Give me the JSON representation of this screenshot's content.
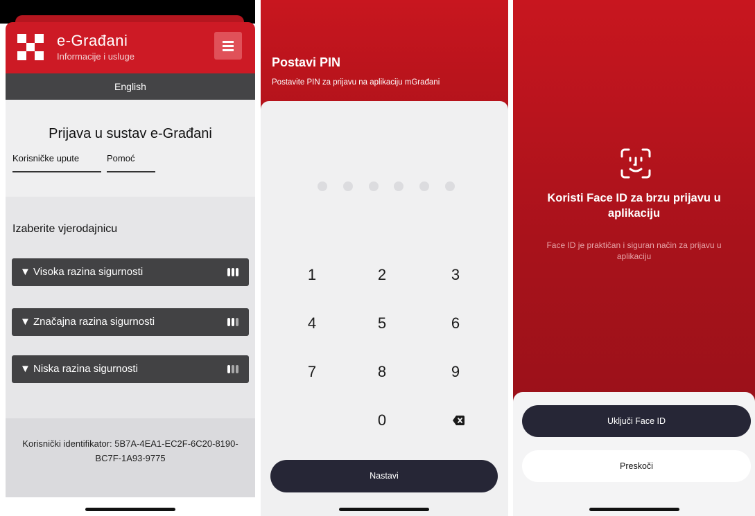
{
  "screen1": {
    "brand_title": "e-Građani",
    "brand_subtitle": "Informacije i usluge",
    "language_link": "English",
    "login_title": "Prijava u sustav e-Građani",
    "links": [
      "Korisničke upute",
      "Pomoć"
    ],
    "credentials_title": "Izaberite vjerodajnicu",
    "levels": [
      {
        "label": "▼ Visoka razina sigurnosti",
        "bars_filled": 3
      },
      {
        "label": "▼ Značajna razina sigurnosti",
        "bars_filled": 2
      },
      {
        "label": "▼ Niska razina sigurnosti",
        "bars_filled": 1
      }
    ],
    "user_identifier": "Korisnički identifikator: 5B7A-4EA1-EC2F-6C20-8190-BC7F-1A93-9775",
    "colors": {
      "brand_red": "#cd1a25",
      "dark_bar": "#424244"
    }
  },
  "screen2": {
    "title": "Postavi PIN",
    "subtitle": "Postavite PIN za prijavu na aplikaciju mGrađani",
    "pin_length": 6,
    "keys": [
      "1",
      "2",
      "3",
      "4",
      "5",
      "6",
      "7",
      "8",
      "9",
      "0"
    ],
    "delete_icon": "backspace-icon",
    "continue_label": "Nastavi"
  },
  "screen3": {
    "icon": "face-id-icon",
    "title": "Koristi Face ID za brzu prijavu u aplikaciju",
    "description": "Face ID je praktičan i siguran način za prijavu u aplikaciju",
    "enable_label": "Uključi Face ID",
    "skip_label": "Preskoči"
  }
}
